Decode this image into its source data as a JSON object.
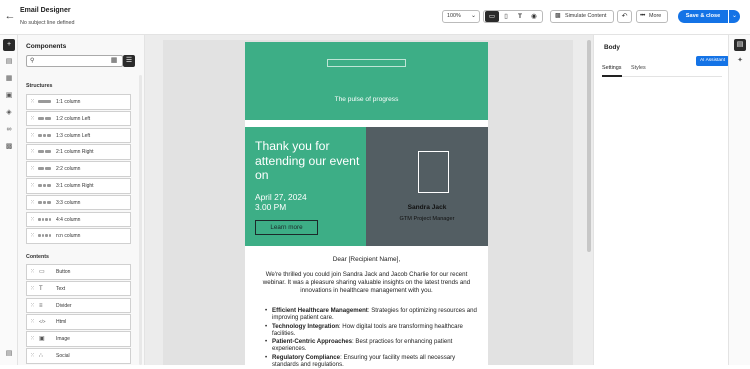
{
  "app": {
    "title": "Email Designer",
    "subtitle": "No subject line defined"
  },
  "toolbar": {
    "zoom": "100%",
    "simulate_label": "Simulate Content",
    "more_label": "More",
    "save_label": "Save & close",
    "devices": [
      "desktop-icon",
      "mobile-icon",
      "text-icon",
      "preview-icon"
    ]
  },
  "components": {
    "title": "Components",
    "search_placeholder": "",
    "structures_title": "Structures",
    "structures": [
      "1:1 column",
      "1:2 column Left",
      "1:3 column Left",
      "2:1 column Right",
      "2:2 column",
      "3:1 column Right",
      "3:3 column",
      "4:4 column",
      "n:n column"
    ],
    "contents_title": "Contents",
    "contents": [
      {
        "label": "Button",
        "icon": "button-icon"
      },
      {
        "label": "Text",
        "icon": "text-icon"
      },
      {
        "label": "Divider",
        "icon": "divider-icon"
      },
      {
        "label": "Html",
        "icon": "code-icon"
      },
      {
        "label": "Image",
        "icon": "image-icon"
      },
      {
        "label": "Social",
        "icon": "share-icon"
      }
    ]
  },
  "email": {
    "tagline": "The pulse of progress",
    "headline": "Thank you for attending  our event on",
    "date": "April 27, 2024",
    "time": "3.00 PM",
    "cta": "Learn more",
    "speaker_name": "Sandra Jack",
    "speaker_role": "GTM Project Manager",
    "greeting": "Dear [Recipient Name],",
    "intro": "We're thrilled you could join Sandra Jack and Jacob Charlie for our recent webinar. It was a pleasure sharing valuable insights on the latest trends and innovations in healthcare management with you.",
    "bullets": [
      {
        "title": "Efficient Healthcare Management",
        "text": ": Strategies for optimizing resources and improving patient care."
      },
      {
        "title": "Technology Integration",
        "text": ": How digital tools are transforming healthcare facilities."
      },
      {
        "title": "Patient-Centric Approaches",
        "text": ": Best practices for enhancing patient experiences."
      },
      {
        "title": "Regulatory Compliance",
        "text": ": Ensuring your facility meets all necessary standards and regulations."
      }
    ],
    "colors": {
      "green": "#3dae86",
      "slate": "#535e63"
    }
  },
  "properties": {
    "title": "Body",
    "tabs": [
      "Settings",
      "Styles"
    ],
    "ai_label": "AI Assistant"
  },
  "accent_color": "#1473e6"
}
